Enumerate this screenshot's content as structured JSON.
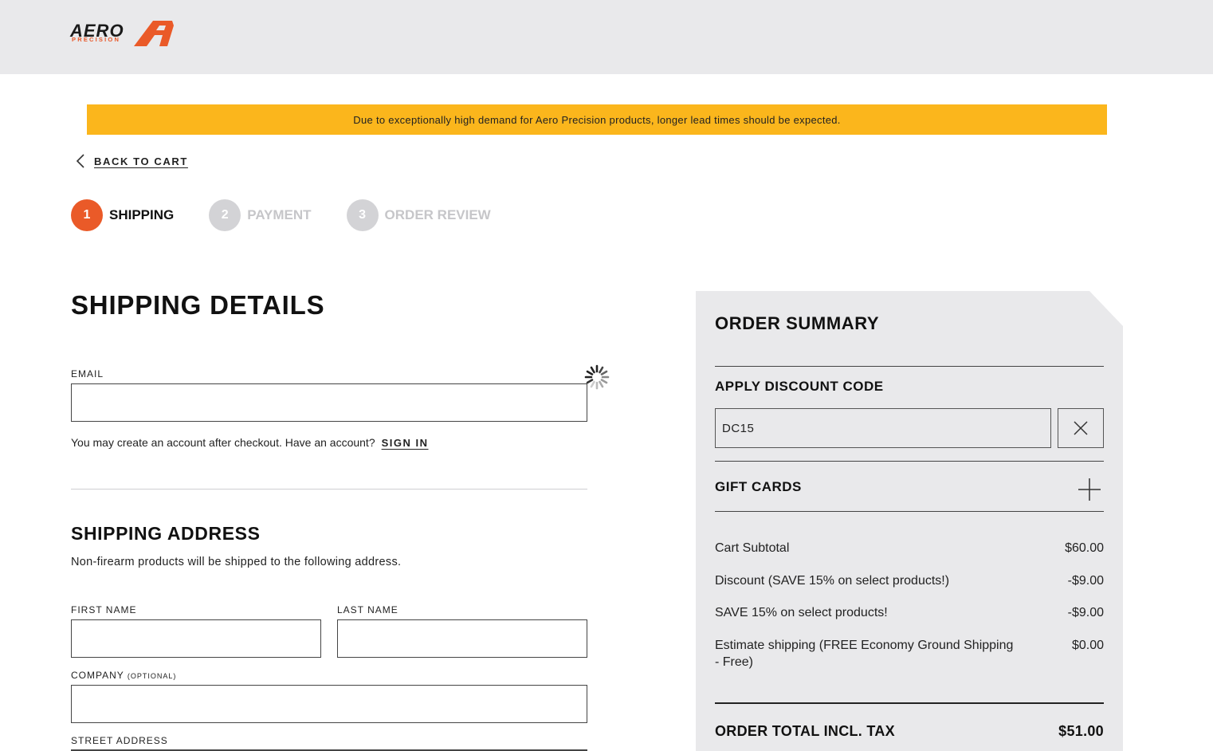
{
  "brand": {
    "name": "AERO",
    "sub": "PRECISION",
    "accent": "#ea5a28"
  },
  "banner": {
    "text": "Due to exceptionally high demand for Aero Precision products, longer lead times should be expected.",
    "color": "#fbb61c"
  },
  "back_link": {
    "label": "BACK TO CART"
  },
  "steps": [
    {
      "num": "1",
      "label": "SHIPPING",
      "active": true
    },
    {
      "num": "2",
      "label": "PAYMENT",
      "active": false
    },
    {
      "num": "3",
      "label": "ORDER REVIEW",
      "active": false
    }
  ],
  "shipping": {
    "title": "SHIPPING DETAILS",
    "email_label": "EMAIL",
    "email_value": "",
    "account_note": "You may create an account after checkout. Have an account?",
    "sign_in": "SIGN IN"
  },
  "address": {
    "title": "SHIPPING ADDRESS",
    "note": "Non-firearm products will be shipped to the following address.",
    "first_name_label": "FIRST NAME",
    "last_name_label": "LAST NAME",
    "company_label": "COMPANY",
    "company_optional": "(OPTIONAL)",
    "street_label": "STREET ADDRESS"
  },
  "summary": {
    "title": "ORDER SUMMARY",
    "discount_title": "APPLY DISCOUNT CODE",
    "discount_code": "DC15",
    "gift_cards": "GIFT CARDS",
    "lines": [
      {
        "label": "Cart Subtotal",
        "value": "$60.00"
      },
      {
        "label": "Discount (SAVE 15% on select products!)",
        "value": "-$9.00"
      },
      {
        "label": "SAVE 15% on select products!",
        "value": "-$9.00"
      },
      {
        "label": "Estimate shipping (FREE Economy Ground Shipping - Free)",
        "value": "$0.00"
      }
    ],
    "total_label": "ORDER TOTAL INCL. TAX",
    "total_value": "$51.00"
  }
}
